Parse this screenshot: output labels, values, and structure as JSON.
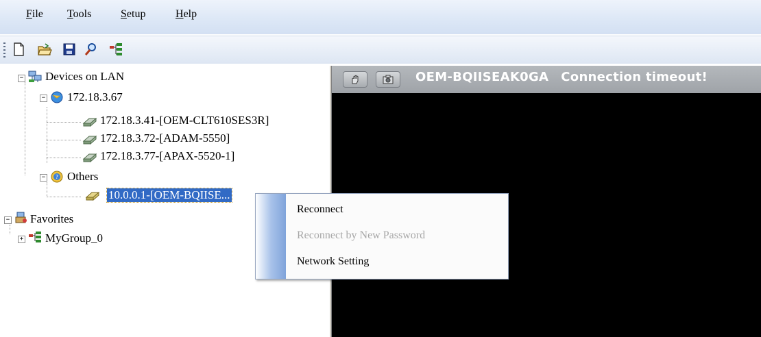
{
  "menubar": {
    "items": [
      {
        "label": "File",
        "u": "F",
        "rest": "ile"
      },
      {
        "label": "Tools",
        "u": "T",
        "rest": "ools"
      },
      {
        "label": "Setup",
        "u": "S",
        "rest": "etup"
      },
      {
        "label": "Help",
        "u": "H",
        "rest": "elp"
      }
    ]
  },
  "toolbar": {
    "buttons": [
      "new-file-icon",
      "open-folder-icon",
      "save-icon",
      "search-icon",
      "group-icon"
    ]
  },
  "tree": {
    "root": "Devices on LAN",
    "subnet": "172.18.3.67",
    "devices": [
      "172.18.3.41-[OEM-CLT610SES3R]",
      "172.18.3.72-[ADAM-5550]",
      "172.18.3.77-[APAX-5520-1]"
    ],
    "others": "Others",
    "others_device": "10.0.0.1-[OEM-BQIISE...",
    "favorites": "Favorites",
    "group": "MyGroup_0"
  },
  "viewer": {
    "device_name": "OEM-BQIISEAK0GA",
    "status": "Connection timeout!"
  },
  "context_menu": {
    "items": [
      {
        "label": "Reconnect",
        "enabled": true
      },
      {
        "label": "Reconnect by New Password",
        "enabled": false
      },
      {
        "label": "Network Setting",
        "enabled": true
      }
    ]
  },
  "colors": {
    "selection": "#316ac5",
    "viewer_bg": "#000000",
    "menubar": "#dce7f6"
  }
}
